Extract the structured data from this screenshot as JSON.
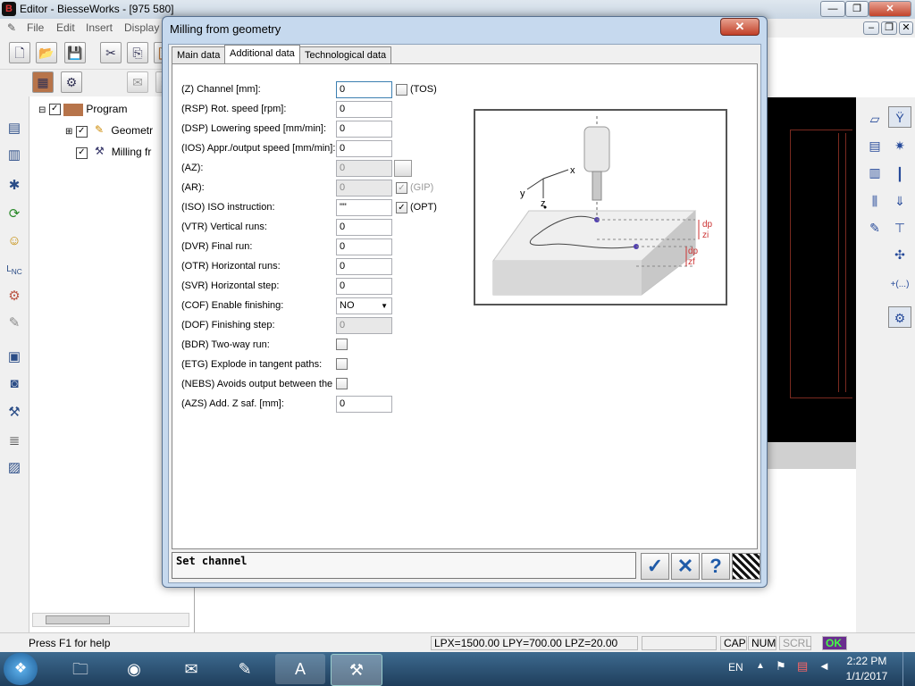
{
  "window": {
    "title": "Editor - BiesseWorks - [975 580]",
    "controls": {
      "minimize": "—",
      "restore": "❐",
      "close": "✕"
    },
    "mdi_controls": {
      "minimize": "–",
      "restore": "❐",
      "close": "✕"
    }
  },
  "menu": [
    "File",
    "Edit",
    "Insert",
    "Display"
  ],
  "tree": {
    "root": "Program",
    "children": [
      "Geometr",
      "Milling fr"
    ]
  },
  "dialog": {
    "title": "Milling from geometry",
    "close": "✕",
    "tabs": [
      "Main data",
      "Additional data",
      "Technological data"
    ],
    "active_tab": "Additional data",
    "fields": [
      {
        "label": "(Z) Channel [mm]:",
        "value": "0"
      },
      {
        "label": "(RSP) Rot. speed [rpm]:",
        "value": "0"
      },
      {
        "label": "(DSP) Lowering speed [mm/min]:",
        "value": "0"
      },
      {
        "label": "(IOS) Appr./output speed [mm/min]:",
        "value": "0"
      },
      {
        "label": "(AZ):",
        "value": "0"
      },
      {
        "label": "(AR):",
        "value": "0"
      },
      {
        "label": "(ISO) ISO instruction:",
        "value": "\"\""
      },
      {
        "label": "(VTR) Vertical runs:",
        "value": "0"
      },
      {
        "label": "(DVR) Final run:",
        "value": "0"
      },
      {
        "label": "(OTR) Horizontal runs:",
        "value": "0"
      },
      {
        "label": "(SVR) Horizontal step:",
        "value": "0"
      },
      {
        "label": "(COF) Enable finishing:",
        "value": "NO"
      },
      {
        "label": "(DOF) Finishing step:",
        "value": "0"
      },
      {
        "label": "(BDR) Two-way run:",
        "value": ""
      },
      {
        "label": "(ETG) Explode in tangent paths:",
        "value": ""
      },
      {
        "label": "(NEBS) Avoids output between the r",
        "value": ""
      },
      {
        "label": "(AZS) Add. Z saf. [mm]:",
        "value": "0"
      }
    ],
    "side_checks": {
      "tos": "(TOS)",
      "gip": "(GIP)",
      "opt": "(OPT)"
    },
    "status_message": "Set channel",
    "diagram_labels": {
      "x": "x",
      "y": "y",
      "z": "z",
      "dp1": "dp",
      "zi": "zi",
      "dp2": "dp",
      "zf": "zf"
    },
    "buttons": {
      "ok": "✓",
      "cancel": "✕",
      "help": "?"
    }
  },
  "statusbar": {
    "help": "Press F1 for help",
    "coords": "LPX=1500.00 LPY=700.00 LPZ=20.00",
    "cap": "CAP",
    "num": "NUM",
    "scrl": "SCRL",
    "ok": "OK"
  },
  "taskbar": {
    "lang": "EN",
    "time": "2:22 PM",
    "date": "1/1/2017"
  },
  "colors": {
    "accent": "#3c7fb1",
    "dialog_frame": "#c6d9ee",
    "black_panel": "#000000",
    "ok_badge": "#6a2d8f"
  }
}
